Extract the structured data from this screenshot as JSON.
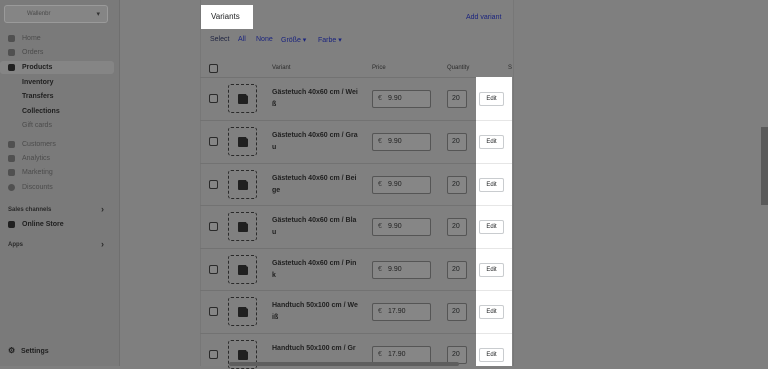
{
  "sidebar": {
    "store_name": "Wallenbr",
    "items": [
      {
        "label": "Home",
        "icon": "home-icon",
        "style": "dim"
      },
      {
        "label": "Orders",
        "icon": "orders-icon",
        "style": "dim"
      },
      {
        "label": "Products",
        "icon": "tag-icon",
        "style": "active"
      },
      {
        "label": "Inventory",
        "icon": "",
        "style": "bold"
      },
      {
        "label": "Transfers",
        "icon": "",
        "style": "bold"
      },
      {
        "label": "Collections",
        "icon": "",
        "style": "bold"
      },
      {
        "label": "Gift cards",
        "icon": "",
        "style": "dim"
      },
      {
        "label": "Customers",
        "icon": "customers-icon",
        "style": "dim"
      },
      {
        "label": "Analytics",
        "icon": "analytics-icon",
        "style": "dim"
      },
      {
        "label": "Marketing",
        "icon": "marketing-icon",
        "style": "dim"
      },
      {
        "label": "Discounts",
        "icon": "discounts-icon",
        "style": "dim"
      }
    ],
    "sales_channels_label": "Sales channels",
    "online_store_label": "Online Store",
    "apps_label": "Apps",
    "settings_label": "Settings"
  },
  "variants": {
    "title": "Variants",
    "add_variant": "Add variant",
    "select_label": "Select",
    "all_label": "All",
    "none_label": "None",
    "size_filter": "Größe ▾",
    "color_filter": "Farbe ▾",
    "columns": {
      "variant": "Variant",
      "price": "Price",
      "quantity": "Quantity",
      "sku": "S"
    },
    "currency": "€",
    "edit_label": "Edit",
    "rows": [
      {
        "name": "Gästetuch 40x60 cm / Wei",
        "name2": "ß",
        "price": "9.90",
        "qty": "20"
      },
      {
        "name": "Gästetuch 40x60 cm / Gra",
        "name2": "u",
        "price": "9.90",
        "qty": "20"
      },
      {
        "name": "Gästetuch 40x60 cm / Bei",
        "name2": "ge",
        "price": "9.90",
        "qty": "20"
      },
      {
        "name": "Gästetuch 40x60 cm / Bla",
        "name2": "u",
        "price": "9.90",
        "qty": "20"
      },
      {
        "name": "Gästetuch 40x60 cm / Pin",
        "name2": "k",
        "price": "9.90",
        "qty": "20"
      },
      {
        "name": "Handtuch 50x100 cm / We",
        "name2": "iß",
        "price": "17.90",
        "qty": "20"
      },
      {
        "name": "Handtuch 50x100 cm / Gr",
        "name2": "",
        "price": "17.90",
        "qty": "20"
      }
    ]
  },
  "colors": {
    "overlay": "#808080",
    "link": "#1a237e",
    "highlight": "#ffffff"
  }
}
